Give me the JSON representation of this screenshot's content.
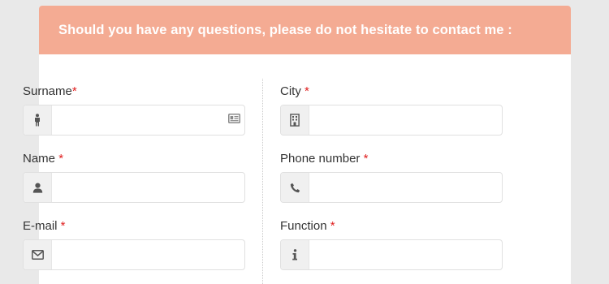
{
  "header": {
    "title": "Should you have any questions, please do not hesitate to contact me :"
  },
  "required_marker": "*",
  "fields": {
    "surname": {
      "label": "Surname",
      "value": "",
      "placeholder": "",
      "icon": "person-standing-icon",
      "suffix_icon": "id-card-icon"
    },
    "city": {
      "label": "City ",
      "value": "",
      "placeholder": "",
      "icon": "building-icon"
    },
    "name": {
      "label": "Name ",
      "value": "",
      "placeholder": "",
      "icon": "user-icon"
    },
    "phone": {
      "label": "Phone number ",
      "value": "",
      "placeholder": "",
      "icon": "phone-icon"
    },
    "email": {
      "label": "E-mail ",
      "value": "",
      "placeholder": "",
      "icon": "envelope-icon"
    },
    "function": {
      "label": "Function ",
      "value": "",
      "placeholder": "",
      "icon": "info-icon"
    }
  },
  "colors": {
    "header_bg": "#f4ab93",
    "required": "#e02020",
    "page_bg": "#e9e9e9"
  }
}
